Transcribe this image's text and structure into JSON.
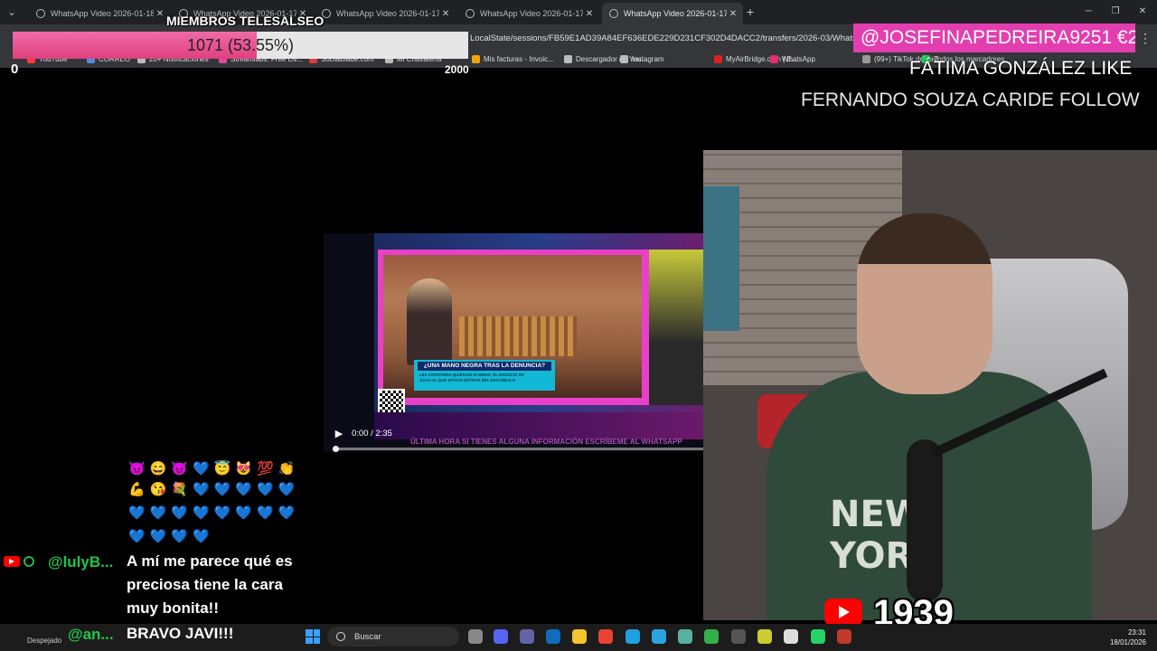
{
  "browser": {
    "tabs": [
      {
        "title": "WhatsApp Video 2026-01-18 a",
        "active": false
      },
      {
        "title": "WhatsApp Video 2026-01-17 a",
        "active": false
      },
      {
        "title": "WhatsApp Video 2026-01-17 a",
        "active": false
      },
      {
        "title": "WhatsApp Video 2026-01-17 a",
        "active": false
      },
      {
        "title": "WhatsApp Video 2026-01-17 a",
        "active": true
      }
    ],
    "new_tab": "+",
    "url": "LocalState/sessions/FB59E1AD39A84EF636EDE229D231CF302D4DACC2/transfers/2026-03/WhatsApp%",
    "bookmarks": [
      "YouTube",
      "CORREO",
      "20+ Notificaciones",
      "Streamlabs: Free Liv...",
      "Socialblade.com",
      "Mi Chavalería",
      "Mis facturas - Invoic...",
      "Descargador de You...",
      "Instagram",
      "MyAirBridge.com | E...",
      "WhatsApp",
      "(99+) TikTok de Javi",
      "Todos los marcadores"
    ]
  },
  "goal": {
    "title": "MIEMBROS TELESALSEO",
    "progress_text": "1071 (53.55%)",
    "current": 1071,
    "fraction": 0.5355,
    "min": "0",
    "max": "2000"
  },
  "alerts": {
    "donation": "@JOSEFINAPEDREIRA9251  €2",
    "like": "FÁTIMA GONZÁLEZ  LIKE",
    "follow": "FERNANDO SOUZA CARIDE  FOLLOW"
  },
  "video": {
    "banner_title": "¿UNA MANO NEGRA TRAS LA DENUNCIA?",
    "banner_sub": "LES CONTAMOS QUIÉN ES RAINIERI, EL EXSOCIO DE JULIO AL QUE SITÚAN DETRÁS DEL ESCÁNDALO",
    "ticker": "ÚLTIMA HORA      SI TIENES ALGUNA INFORMACIÓN ESCRÍBEME AL WHATSAPP",
    "time": "0:00 / 2:35",
    "progress": 0
  },
  "subscribers": {
    "count": "1939"
  },
  "chat": {
    "emoji_rows": [
      "😈😄😈💙😇😻💯👏",
      "💪😘💐💙💙💙💙💙",
      "💙💙💙💙💙💙💙💙",
      "💙💙💙💙"
    ],
    "messages": [
      {
        "user": "@lulyB...",
        "lines": [
          "A mí me parece qué es",
          "preciosa tiene la cara",
          "muy bonita!!"
        ]
      },
      {
        "user": "@an...",
        "lines": [
          "BRAVO JAVI!!!"
        ]
      }
    ]
  },
  "taskbar": {
    "weather": "Despejado",
    "search_placeholder": "Buscar",
    "time": "23:31",
    "date": "18/01/2026"
  }
}
